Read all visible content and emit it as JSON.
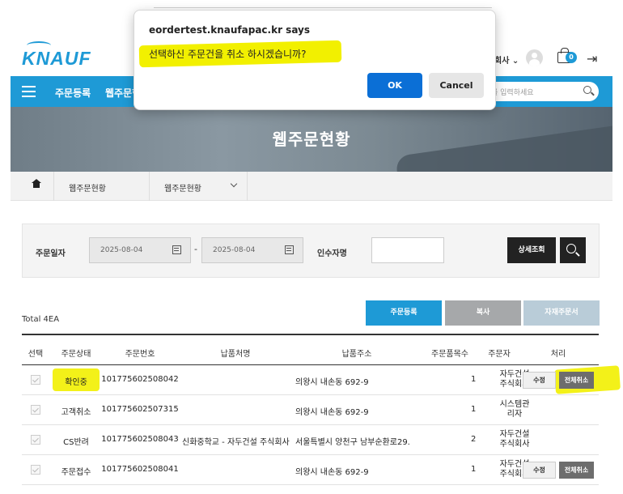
{
  "header": {
    "logo": "KNAUF",
    "user_label": "회사",
    "cart_count": "0"
  },
  "nav": {
    "items": [
      "주문등록",
      "웹주문현"
    ],
    "search_placeholder": "를 입력하세요"
  },
  "banner": {
    "title": "웹주문현황"
  },
  "breadcrumb": {
    "item1": "웹주문현황",
    "item2": "웹주문현황"
  },
  "search_panel": {
    "order_date_label": "주문일자",
    "date_from": "2025-08-04",
    "date_separator": "-",
    "date_to": "2025-08-04",
    "receiver_label": "인수자명",
    "receiver_value": "",
    "detail_button": "상세조회"
  },
  "total": "Total 4EA",
  "actions": {
    "order_register": "주문등록",
    "copy": "복사",
    "material_order": "자재주문서",
    "colors": {
      "register": "#1e9ad6",
      "copy": "#a6a8aa",
      "material": "#b9ccd8"
    }
  },
  "table": {
    "headers": [
      "선택",
      "주문상태",
      "주문번호",
      "납품처명",
      "납품주소",
      "주문품목수",
      "주문자",
      "처리"
    ],
    "rows": [
      {
        "status": "확인중",
        "order_no": "101775602508042",
        "site": "",
        "address": "의왕시 내손동 692-9",
        "items": "1",
        "orderer": "자두건설 주식회사",
        "edit": "수정",
        "cancel": "전체취소"
      },
      {
        "status": "고객취소",
        "order_no": "101775602507315",
        "site": "",
        "address": "의왕시 내손동 692-9",
        "items": "1",
        "orderer": "시스템관 리자",
        "edit": "",
        "cancel": ""
      },
      {
        "status": "CS반려",
        "order_no": "101775602508043",
        "site": "신화중학교 - 자두건설 주식회사",
        "address": "서울특별시 양천구 남부순환로29.",
        "items": "2",
        "orderer": "자두건설 주식회사",
        "edit": "",
        "cancel": ""
      },
      {
        "status": "주문접수",
        "order_no": "101775602508041",
        "site": "",
        "address": "의왕시 내손동 692-9",
        "items": "1",
        "orderer": "자두건설 주식회사",
        "edit": "수정",
        "cancel": "전체취소"
      }
    ]
  },
  "dialog": {
    "title": "eordertest.knaufapac.kr says",
    "message": "선택하신 주문건을 취소 하시겠습니까?",
    "ok": "OK",
    "cancel": "Cancel"
  },
  "colors": {
    "accent": "#1e9ad6",
    "highlight": "#f2f000",
    "ok_button": "#0b6fd6"
  }
}
